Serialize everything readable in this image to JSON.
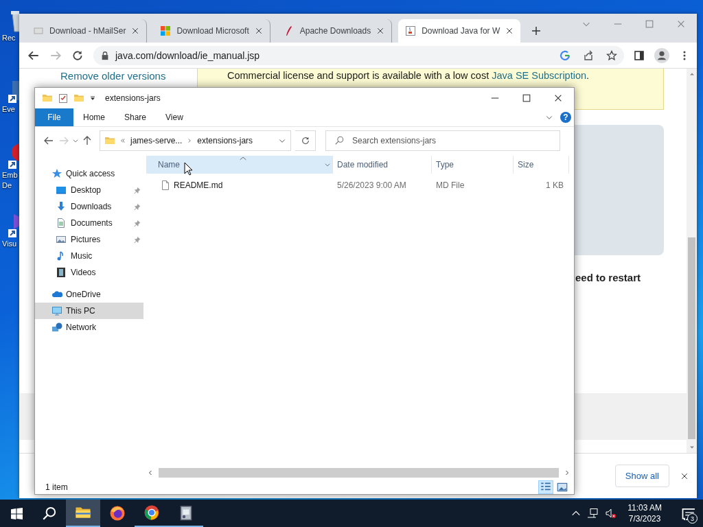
{
  "desktop": {
    "icons": [
      {
        "kind": "bin",
        "lines": [
          "Rec"
        ]
      },
      {
        "kind": "shortcut",
        "lines": [
          "Eve"
        ]
      },
      {
        "kind": "red-app",
        "lines": [
          "Emb",
          "De"
        ]
      },
      {
        "kind": "purple-app",
        "lines": [
          "Visu"
        ]
      }
    ]
  },
  "browser": {
    "tabs": [
      {
        "title": "Download - hMailSer",
        "kind": "page",
        "selected": false
      },
      {
        "title": "Download Microsoft",
        "kind": "squares",
        "selected": false
      },
      {
        "title": "Apache Downloads",
        "kind": "feather",
        "selected": false
      },
      {
        "title": "Download Java for W",
        "kind": "cup",
        "selected": true
      }
    ],
    "address": "java.com/download/ie_manual.jsp",
    "page": {
      "side_link": "Remove older versions",
      "notice": {
        "text": "Commercial license and support is available with a low cost ",
        "link": "Java SE Subscription",
        "end": "."
      },
      "heading": "eed to restart"
    },
    "download_bar": {
      "button": "Show all"
    }
  },
  "explorer": {
    "title": "extensions-jars",
    "ribbon_tabs": [
      {
        "label": "File",
        "selected": true
      },
      {
        "label": "Home",
        "selected": false
      },
      {
        "label": "Share",
        "selected": false
      },
      {
        "label": "View",
        "selected": false
      }
    ],
    "help": "?",
    "path": [
      "james-serve...",
      "extensions-jars"
    ],
    "search_placeholder": "Search extensions-jars",
    "columns": [
      {
        "label": "Name",
        "hovered": true,
        "sorted": true
      },
      {
        "label": "Date modified",
        "hovered": false,
        "sorted": false
      },
      {
        "label": "Type",
        "hovered": false,
        "sorted": false
      },
      {
        "label": "Size",
        "hovered": false,
        "sorted": false
      }
    ],
    "sidebar": [
      {
        "label": "Quick access",
        "kind": "star",
        "selected": false,
        "children": [
          {
            "label": "Desktop",
            "kind": "desktop",
            "selected": false,
            "pinned": true
          },
          {
            "label": "Downloads",
            "kind": "download",
            "selected": false,
            "pinned": true
          },
          {
            "label": "Documents",
            "kind": "document",
            "selected": false,
            "pinned": true
          },
          {
            "label": "Pictures",
            "kind": "pictures",
            "selected": false,
            "pinned": true
          },
          {
            "label": "Music",
            "kind": "music",
            "selected": false,
            "pinned": false
          },
          {
            "label": "Videos",
            "kind": "videos",
            "selected": false,
            "pinned": false
          }
        ]
      },
      {
        "label": "OneDrive",
        "kind": "onedrive",
        "selected": false
      },
      {
        "label": "This PC",
        "kind": "pc",
        "selected": true
      },
      {
        "label": "Network",
        "kind": "network",
        "selected": false
      }
    ],
    "files": [
      {
        "name": "README.md",
        "date": "5/26/2023 9:00 AM",
        "type": "MD File",
        "size": "1 KB",
        "selected": false
      }
    ],
    "status": "1 item",
    "views": [
      {
        "kind": "details",
        "selected": true
      },
      {
        "kind": "large-icons",
        "selected": false
      }
    ]
  },
  "taskbar": {
    "apps": [
      {
        "kind": "explorer",
        "active": true,
        "running": true
      },
      {
        "kind": "firefox",
        "active": false,
        "running": false
      },
      {
        "kind": "chrome",
        "active": false,
        "running": true
      },
      {
        "kind": "tool",
        "active": false,
        "running": true
      }
    ],
    "time": "11:03 AM",
    "date": "7/3/2023",
    "notifications": "3"
  }
}
